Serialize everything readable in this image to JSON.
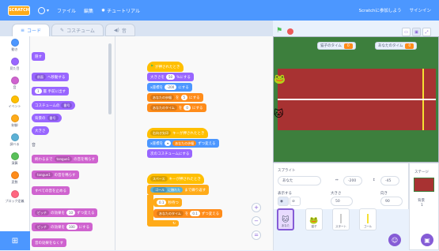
{
  "menubar": {
    "logo": "SCRATCH",
    "file": "ファイル",
    "edit": "編集",
    "tutorial": "チュートリアル",
    "join": "Scratchに参加しよう",
    "signin": "サインイン"
  },
  "tabs": {
    "code": "コード",
    "costume": "コスチューム",
    "sound": "音"
  },
  "categories": [
    {
      "label": "動き",
      "color": "#4c97ff"
    },
    {
      "label": "見た目",
      "color": "#9966ff"
    },
    {
      "label": "音",
      "color": "#cf63cf"
    },
    {
      "label": "イベント",
      "color": "#ffbf00"
    },
    {
      "label": "制御",
      "color": "#ffab19"
    },
    {
      "label": "調べる",
      "color": "#5cb1d6"
    },
    {
      "label": "演算",
      "color": "#59c059"
    },
    {
      "label": "変数",
      "color": "#ff8c1a"
    },
    {
      "label": "ブロック定義",
      "color": "#ff6680"
    }
  ],
  "palette": {
    "b0": "隠す",
    "b1a": "前面",
    "b1b": "へ移動する",
    "b2a": "1",
    "b2b": "層 手前に出す",
    "b3a": "コスチュームの",
    "b3b": "番号",
    "b4a": "背景の",
    "b4b": "番号",
    "b5": "大きさ",
    "section_sound": "音",
    "b6a": "終わるまで",
    "b6b": "tongue1",
    "b6c": "の音を鳴らす",
    "b7a": "tongue1",
    "b7b": "の音を鳴らす",
    "b8": "すべての音を止める",
    "b9a": "ピッチ",
    "b9b": "の効果を",
    "b9c": "10",
    "b9d": "ずつ変える",
    "b10a": "ピッチ",
    "b10b": "の効果を",
    "b10c": "100",
    "b10d": "にする",
    "b11": "音の効果をなくす"
  },
  "scripts": {
    "s1_hat": "が押されたとき",
    "s1_b1a": "大きさを",
    "s1_b1b": "50",
    "s1_b1c": "%にする",
    "s1_b2a": "x座標を",
    "s1_b2b": "-200",
    "s1_b2c": "にする",
    "s1_b3a": "あなたの歩幅",
    "s1_b3b": "を",
    "s1_b3c": "5",
    "s1_b3d": "にする",
    "s1_b4a": "あなたのタイム",
    "s1_b4b": "を",
    "s1_b4c": "0",
    "s1_b4d": "にする",
    "s2_hat_a": "右向き矢印",
    "s2_hat_b": "キーが押されたとき",
    "s2_b1a": "x座標を",
    "s2_b1b": "あなたの歩幅",
    "s2_b1c": "ずつ変える",
    "s2_b2": "次のコスチュームにする",
    "s3_hat_a": "スペース",
    "s3_hat_b": "キーが押されたとき",
    "s3_b1a": "ゴール",
    "s3_b1b": "に触れた",
    "s3_b1c": "まで繰り返す",
    "s3_b2a": "0.1",
    "s3_b2b": "秒待つ",
    "s3_b3a": "あなたのタイム",
    "s3_b3b": "を",
    "s3_b3c": "0.1",
    "s3_b3d": "ずつ変える"
  },
  "zoom": {
    "in": "+",
    "out": "−",
    "reset": "="
  },
  "stage": {
    "monitor1_label": "猫子のタイム",
    "monitor1_value": "0",
    "monitor2_label": "あなたのタイム",
    "monitor2_value": "0"
  },
  "sprite_info": {
    "title": "スプライト",
    "name": "あなた",
    "x_label": "↔",
    "x_value": "-200",
    "y_label": "↕",
    "y_value": "-45",
    "show_label": "表示する",
    "size_label": "大きさ",
    "size_value": "50",
    "dir_label": "向き",
    "dir_value": "90"
  },
  "sprites": [
    "あなた",
    "猫子",
    "スタート",
    "ゴール"
  ],
  "stage_panel": {
    "title": "ステージ",
    "bg_label": "背景",
    "bg_count": "1"
  }
}
